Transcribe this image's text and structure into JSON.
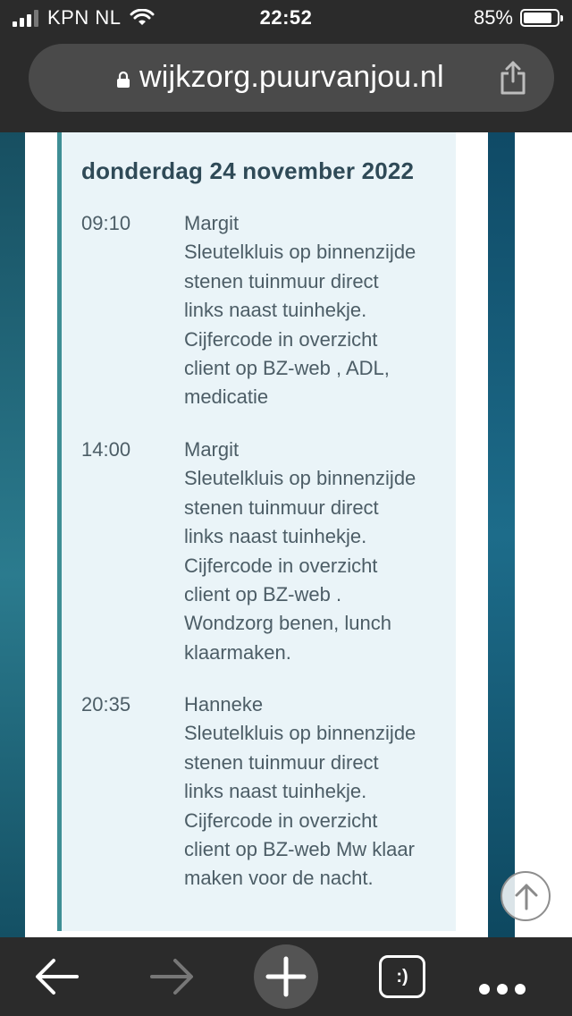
{
  "status_bar": {
    "carrier": "KPN NL",
    "time": "22:52",
    "battery": "85%",
    "battery_level": 0.85
  },
  "address_bar": {
    "url": "wijkzorg.puurvanjou.nl"
  },
  "schedule": {
    "day_title": "donderdag 24 november 2022",
    "entries": [
      {
        "time": "09:10",
        "lines": [
          "Margit",
          "Sleutelkluis op binnenzijde",
          "stenen tuinmuur direct",
          "links naast tuinhekje.",
          "Cijfercode in overzicht",
          "client op BZ-web , ADL,",
          "medicatie"
        ]
      },
      {
        "time": "14:00",
        "lines": [
          "Margit",
          "Sleutelkluis op binnenzijde",
          "stenen tuinmuur direct",
          "links naast tuinhekje.",
          "Cijfercode in overzicht",
          "client op BZ-web .",
          "Wondzorg benen, lunch",
          "klaarmaken."
        ]
      },
      {
        "time": "20:35",
        "lines": [
          "Hanneke",
          "Sleutelkluis op binnenzijde",
          "stenen tuinmuur direct",
          "links naast tuinhekje.",
          "Cijfercode in overzicht",
          "client op BZ-web Mw klaar",
          "maken voor de nacht."
        ]
      }
    ]
  },
  "toolbar": {
    "tabs_label": ":)"
  },
  "icons": {
    "back": "arrow-left-icon",
    "forward": "arrow-right-icon",
    "new_tab": "plus-icon",
    "tabs": "tabs-icon",
    "more": "more-dots-icon",
    "share": "share-icon",
    "lock": "lock-icon",
    "scroll_top": "arrow-up-circle-icon"
  },
  "colors": {
    "accent_border": "#3e8e95",
    "card_background": "#eaf4f8",
    "title_text": "#2f4a57"
  }
}
